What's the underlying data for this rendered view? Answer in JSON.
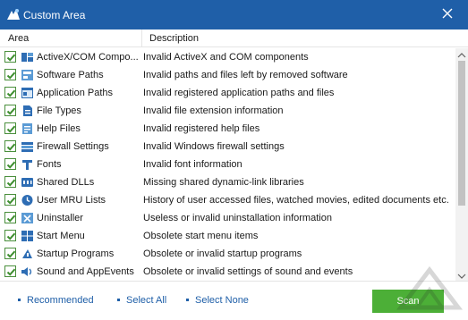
{
  "window": {
    "title": "Custom Area",
    "accent_color": "#1f5fa8",
    "close_icon": "close-icon"
  },
  "list": {
    "columns": {
      "area": "Area",
      "description": "Description"
    },
    "rows": [
      {
        "area": "ActiveX/COM Compo...",
        "description": "Invalid ActiveX and COM components",
        "icon": "activex-icon",
        "checked": true
      },
      {
        "area": "Software Paths",
        "description": "Invalid paths and files left by removed software",
        "icon": "software-paths-icon",
        "checked": true
      },
      {
        "area": "Application Paths",
        "description": "Invalid registered application paths and files",
        "icon": "application-paths-icon",
        "checked": true
      },
      {
        "area": "File Types",
        "description": "Invalid file extension information",
        "icon": "file-types-icon",
        "checked": true
      },
      {
        "area": "Help Files",
        "description": "Invalid registered help files",
        "icon": "help-files-icon",
        "checked": true
      },
      {
        "area": "Firewall Settings",
        "description": "Invalid Windows firewall settings",
        "icon": "firewall-icon",
        "checked": true
      },
      {
        "area": "Fonts",
        "description": "Invalid font information",
        "icon": "fonts-icon",
        "checked": true
      },
      {
        "area": "Shared DLLs",
        "description": "Missing shared dynamic-link libraries",
        "icon": "shared-dlls-icon",
        "checked": true
      },
      {
        "area": "User MRU Lists",
        "description": "History of user accessed files, watched movies, edited documents etc.",
        "icon": "mru-icon",
        "checked": true
      },
      {
        "area": "Uninstaller",
        "description": "Useless or invalid uninstallation information",
        "icon": "uninstaller-icon",
        "checked": true
      },
      {
        "area": "Start Menu",
        "description": "Obsolete start menu items",
        "icon": "start-menu-icon",
        "checked": true
      },
      {
        "area": "Startup Programs",
        "description": "Obsolete or invalid startup programs",
        "icon": "startup-icon",
        "checked": true
      },
      {
        "area": "Sound and AppEvents",
        "description": "Obsolete or invalid settings of sound and events",
        "icon": "sound-icon",
        "checked": true
      }
    ]
  },
  "footer": {
    "recommended": "Recommended",
    "select_all": "Select All",
    "select_none": "Select None",
    "scan": "Scan",
    "scan_color": "#4caf37"
  }
}
